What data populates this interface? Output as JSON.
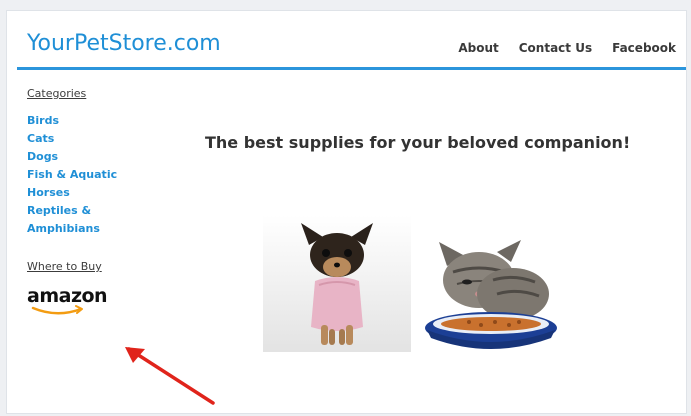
{
  "site": {
    "logo": "YourPetStore.com"
  },
  "nav": {
    "about": "About",
    "contact": "Contact Us",
    "facebook": "Facebook"
  },
  "sidebar": {
    "categories_heading": "Categories",
    "categories": [
      "Birds",
      "Cats",
      "Dogs",
      "Fish & Aquatic",
      "Horses",
      "Reptiles &",
      "Amphibians"
    ],
    "where_heading": "Where to Buy",
    "amazon_label": "amazon"
  },
  "main": {
    "tagline": "The best supplies for your beloved companion!"
  },
  "colors": {
    "accent": "#2b95dc",
    "link": "#1f8fd6",
    "arrow": "#e0241b",
    "amazon_smile": "#f39c12"
  }
}
